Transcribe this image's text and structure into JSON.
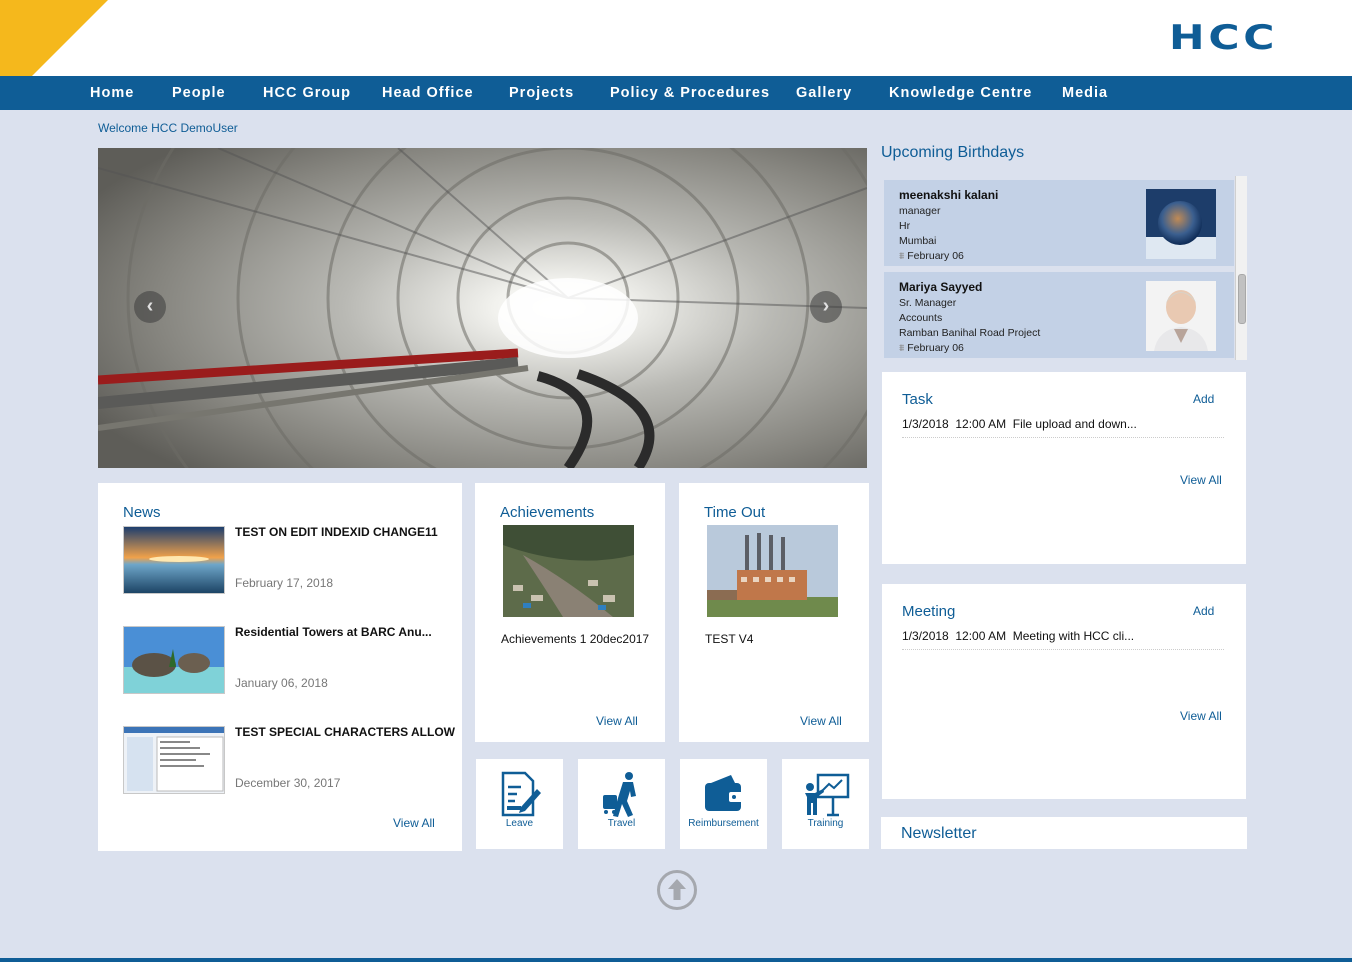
{
  "logo": "HCC",
  "nav": [
    "Home",
    "People",
    "HCC Group",
    "Head Office",
    "Projects",
    "Policy & Procedures",
    "Gallery",
    "Knowledge Centre",
    "Media"
  ],
  "welcome": "Welcome HCC DemoUser",
  "slider": {
    "prev_icon": "chevron-left-icon",
    "next_icon": "chevron-right-icon"
  },
  "news": {
    "title": "News",
    "items": [
      {
        "title": "TEST ON EDIT INDEXID CHANGE11",
        "date": "February 17, 2018"
      },
      {
        "title": "Residential Towers at BARC Anu...",
        "date": "January 06, 2018"
      },
      {
        "title": "TEST SPECIAL CHARACTERS ALLOW",
        "date": "December 30, 2017"
      }
    ],
    "view_all": "View All"
  },
  "achievements": {
    "title": "Achievements",
    "caption": "Achievements 1 20dec2017",
    "view_all": "View All"
  },
  "timeout": {
    "title": "Time Out",
    "caption": "TEST V4",
    "view_all": "View All"
  },
  "tiles": [
    {
      "label": "Leave",
      "icon": "leave-form-icon"
    },
    {
      "label": "Travel",
      "icon": "traveler-icon"
    },
    {
      "label": "Reimbursement",
      "icon": "wallet-icon"
    },
    {
      "label": "Training",
      "icon": "training-board-icon"
    }
  ],
  "birthdays": {
    "title": "Upcoming Birthdays",
    "items": [
      {
        "name": "meenakshi kalani",
        "designation": "manager",
        "department": "Hr",
        "location": "Mumbai",
        "date": "February 06"
      },
      {
        "name": "Mariya Sayyed",
        "designation": "Sr. Manager",
        "department": "Accounts",
        "location": "Ramban Banihal Road Project",
        "date": "February 06"
      }
    ]
  },
  "task": {
    "title": "Task",
    "add": "Add",
    "entry": "1/3/2018  12:00 AM  File upload and down...",
    "view_all": "View All"
  },
  "meeting": {
    "title": "Meeting",
    "add": "Add",
    "entry": "1/3/2018  12:00 AM  Meeting with HCC cli...",
    "view_all": "View All"
  },
  "newsletter": {
    "title": "Newsletter"
  },
  "colors": {
    "brand": "#0f5d96",
    "page_bg": "#dbe1ee",
    "birthday_card": "#c3d1e6",
    "accent_yellow": "#f5b81c"
  }
}
